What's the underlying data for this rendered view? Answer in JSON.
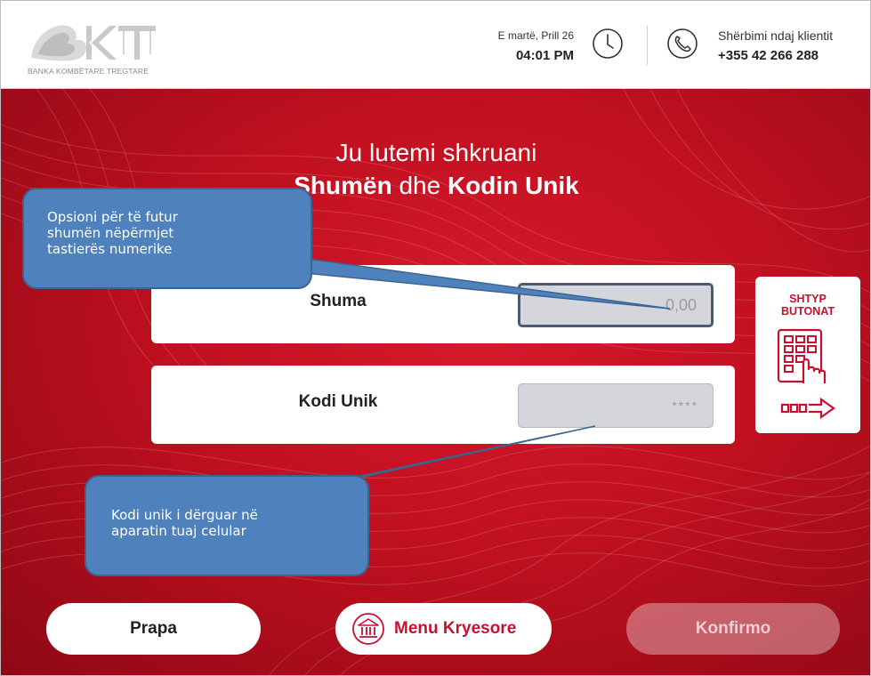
{
  "header": {
    "logo_text": "BKT",
    "logo_subtitle": "BANKA KOMBËTARE TREGTARE",
    "date": "E martë, Prill 26",
    "time": "04:01 PM",
    "service_label": "Shërbimi ndaj klientit",
    "service_phone": "+355 42 266 288"
  },
  "main": {
    "title_line1": "Ju lutemi shkruani",
    "title_bold1": "Shumën",
    "title_mid": " dhe ",
    "title_bold2": "Kodin Unik",
    "amount_label": "Shuma",
    "amount_value": "0,00",
    "code_label": "Kodi Unik",
    "code_value": "****",
    "keypad_line1": "SHTYP",
    "keypad_line2": "BUTONAT"
  },
  "callouts": {
    "amount_note": [
      "Opsioni për të futur",
      "shumën nëpërmjet",
      "tastierës numerike"
    ],
    "code_note": [
      "Kodi unik i dërguar në",
      "aparatin tuaj celular"
    ]
  },
  "buttons": {
    "back": "Prapa",
    "menu": "Menu Kryesore",
    "confirm": "Konfirmo"
  },
  "colors": {
    "brand_red": "#c8102e",
    "callout_blue": "#4f81bd"
  }
}
